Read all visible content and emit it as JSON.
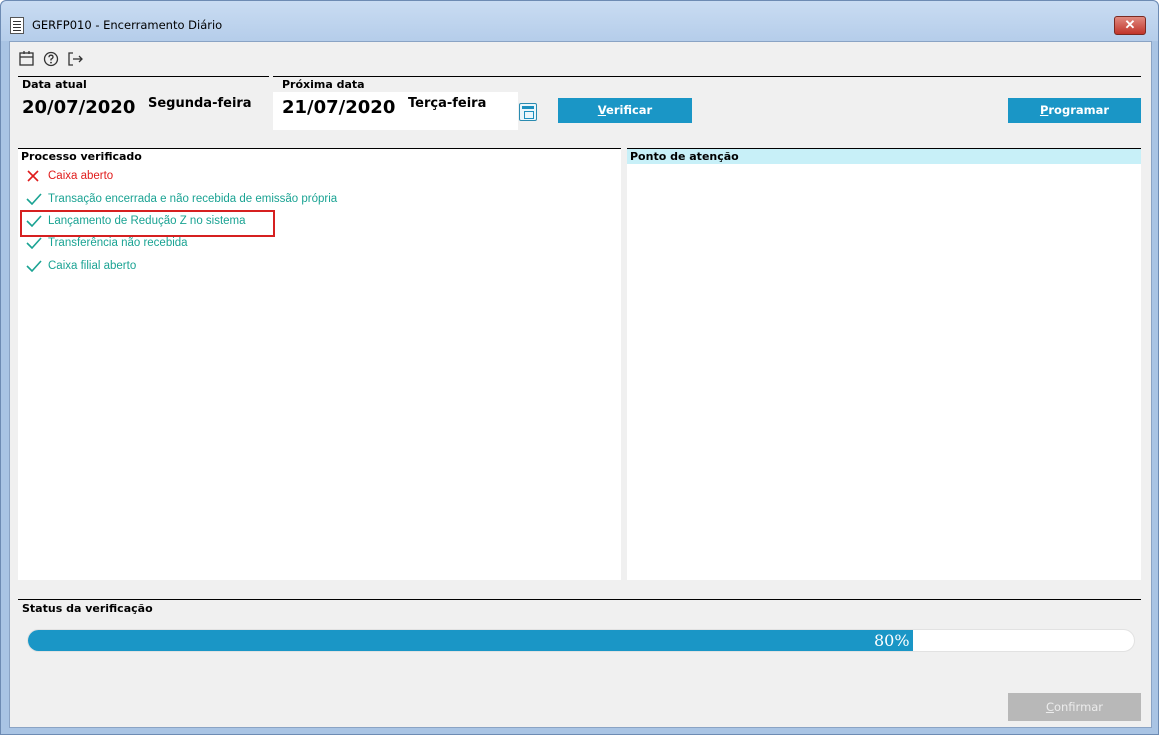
{
  "window": {
    "title": "GERFP010 - Encerramento Diário",
    "close_glyph": "✕"
  },
  "toolbar": {
    "icons": [
      "calendar-icon",
      "help-icon",
      "exit-icon"
    ]
  },
  "dates": {
    "current_label": "Data atual",
    "current_date": "20/07/2020",
    "current_day": "Segunda-feira",
    "next_label": "Próxima data",
    "next_date": "21/07/2020",
    "next_day": "Terça-feira"
  },
  "buttons": {
    "verify_first": "V",
    "verify_rest": "erificar",
    "schedule_first": "P",
    "schedule_rest": "rogramar",
    "confirm_first": "C",
    "confirm_rest": "onfirmar"
  },
  "process_panel": {
    "title": "Processo verificado",
    "items": [
      {
        "status": "error",
        "label": "Caixa aberto"
      },
      {
        "status": "ok",
        "label": "Transação encerrada e não recebida de emissão própria"
      },
      {
        "status": "ok",
        "label": "Lançamento de Redução Z no sistema"
      },
      {
        "status": "ok",
        "label": "Transferência não recebida"
      },
      {
        "status": "ok",
        "label": "Caixa filial aberto"
      }
    ]
  },
  "attention_panel": {
    "title": "Ponto de atenção"
  },
  "status": {
    "title": "Status da verificação",
    "progress_percent": 80,
    "progress_text": "80%"
  },
  "colors": {
    "accent": "#1a96c6",
    "ok": "#1aa393",
    "error": "#e01b1b",
    "attention_header": "#c8f0f8"
  }
}
